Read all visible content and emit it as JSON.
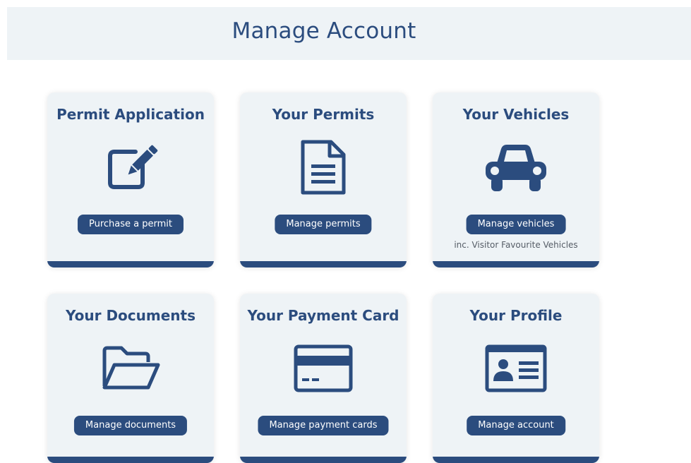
{
  "page": {
    "title": "Manage Account"
  },
  "cards": [
    {
      "title": "Permit Application",
      "icon": "edit-icon",
      "button": "Purchase a permit"
    },
    {
      "title": "Your Permits",
      "icon": "document-icon",
      "button": "Manage permits"
    },
    {
      "title": "Your Vehicles",
      "icon": "car-icon",
      "button": "Manage vehicles",
      "note": "inc. Visitor Favourite Vehicles"
    },
    {
      "title": "Your Documents",
      "icon": "folder-open-icon",
      "button": "Manage documents"
    },
    {
      "title": "Your Payment Card",
      "icon": "credit-card-icon",
      "button": "Manage payment cards"
    },
    {
      "title": "Your Profile",
      "icon": "id-card-icon",
      "button": "Manage account"
    }
  ],
  "colors": {
    "primary": "#2b4c7e",
    "card_background": "#eef3f6",
    "header_background": "#eef3f6",
    "note_text": "#555c66"
  }
}
